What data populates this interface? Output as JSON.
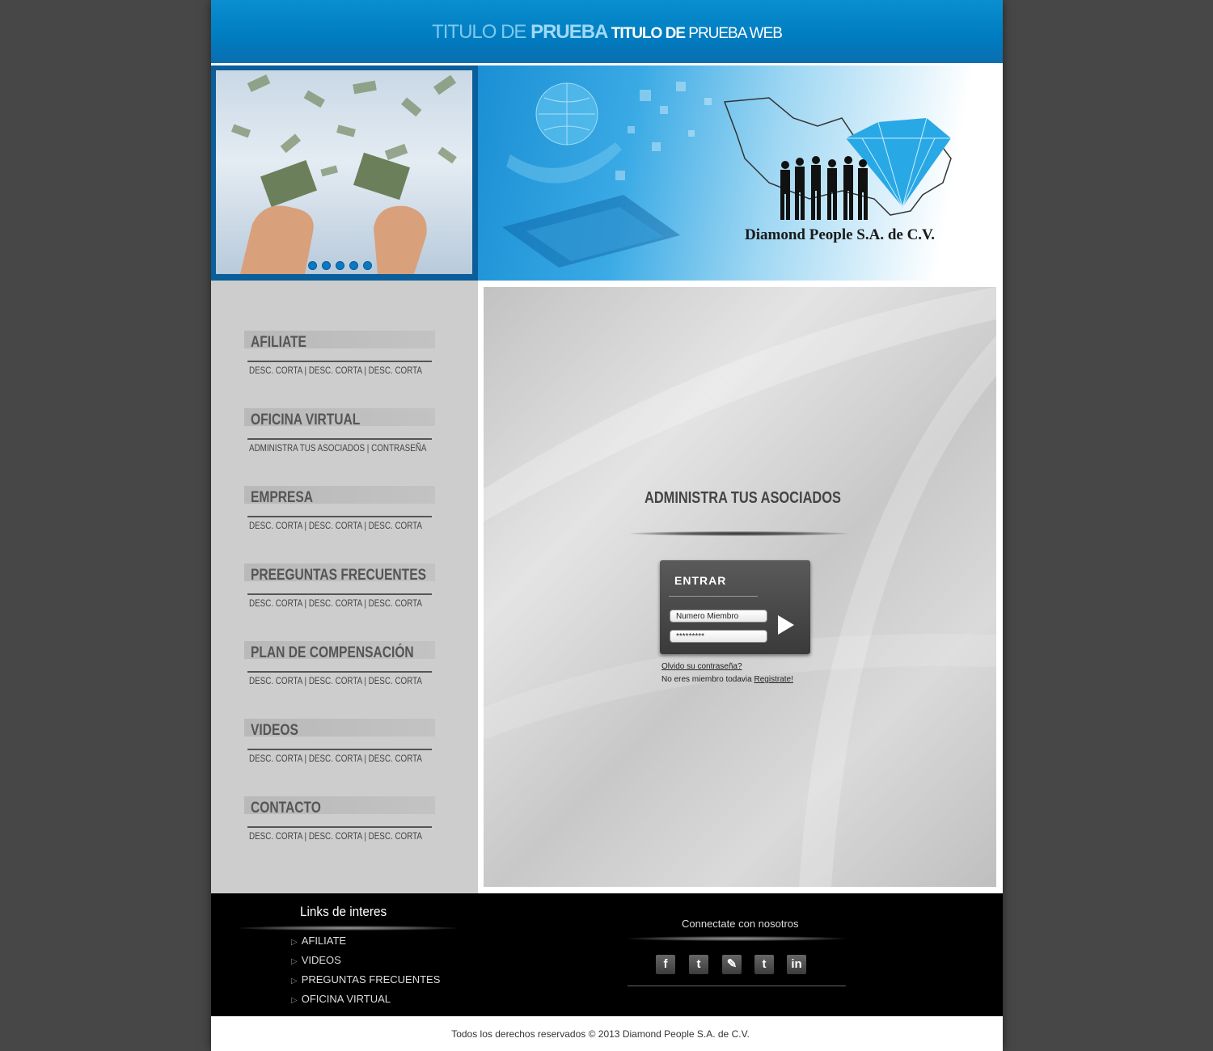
{
  "header": {
    "title_part1": "TITULO DE ",
    "title_part2": "PRUEBA",
    "title_part3": " TITULO DE ",
    "title_part4": "PRUEBA WEB"
  },
  "banner": {
    "logo_text": "Diamond People S.A. de C.V.",
    "slider_dots": 5,
    "active_dot": 1
  },
  "sidebar": {
    "items": [
      {
        "title": "AFILIATE",
        "desc": "DESC. CORTA | DESC. CORTA | DESC. CORTA"
      },
      {
        "title": "OFICINA VIRTUAL",
        "desc": "ADMINISTRA TUS ASOCIADOS | CONTRASEÑA"
      },
      {
        "title": "EMPRESA",
        "desc": "DESC. CORTA | DESC. CORTA | DESC. CORTA"
      },
      {
        "title": "PREEGUNTAS FRECUENTES",
        "desc": "DESC. CORTA | DESC. CORTA | DESC. CORTA"
      },
      {
        "title": "PLAN DE COMPENSACIÓN",
        "desc": "DESC. CORTA | DESC. CORTA | DESC. CORTA"
      },
      {
        "title": "VIDEOS",
        "desc": "DESC. CORTA | DESC. CORTA | DESC. CORTA"
      },
      {
        "title": "CONTACTO",
        "desc": "DESC. CORTA | DESC. CORTA | DESC. CORTA"
      }
    ]
  },
  "main": {
    "title": "ADMINISTRA TUS ASOCIADOS",
    "login": {
      "label": "ENTRAR",
      "member_value": "Numero Miembro",
      "password_value": "*********",
      "forgot_link": "Olvido su contraseña?",
      "not_member_text": "No eres miembro todavia ",
      "register_link": "Registrate!"
    }
  },
  "footer": {
    "links_title": "Links de interes",
    "links": [
      "AFILIATE",
      "VIDEOS",
      "PREGUNTAS FRECUENTES",
      "OFICINA VIRTUAL"
    ],
    "connect_title": "Connectate con nosotros",
    "social": [
      {
        "name": "facebook",
        "glyph": "f"
      },
      {
        "name": "twitter",
        "glyph": "t"
      },
      {
        "name": "myspace",
        "glyph": "✎"
      },
      {
        "name": "tumblr",
        "glyph": "t"
      },
      {
        "name": "linkedin",
        "glyph": "in"
      }
    ],
    "copyright": "Todos los derechos reservados © 2013 Diamond People S.A. de C.V."
  },
  "colors": {
    "header_blue": "#0a8fd0",
    "page_bg": "#474747",
    "sidebar_bg": "#cdcdcd",
    "footer_bg": "#000000"
  }
}
